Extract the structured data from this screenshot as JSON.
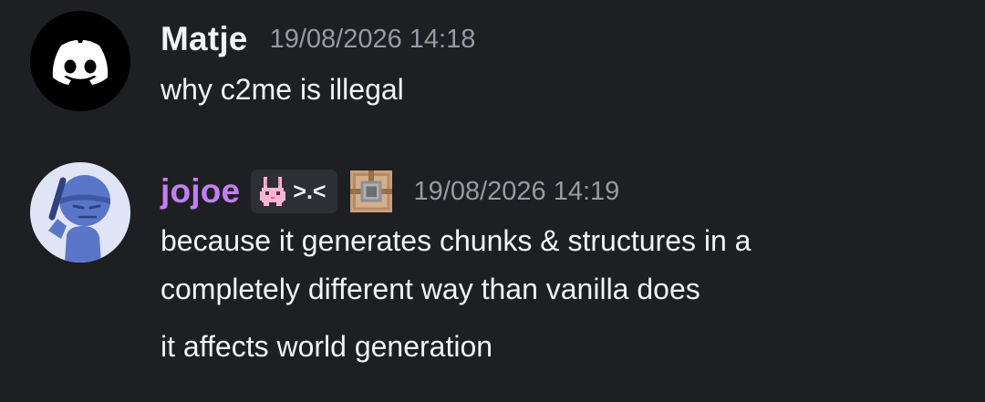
{
  "messages": [
    {
      "username": "Matje",
      "username_color": "#f2f3f5",
      "timestamp": "19/08/2026 14:18",
      "avatar_icon": "discord-logo-icon",
      "lines": [
        "why c2me is illegal"
      ]
    },
    {
      "username": "jojoe",
      "username_color": "#c27ff2",
      "timestamp": "19/08/2026 14:19",
      "avatar_icon": "user-avatar",
      "tag": {
        "icon": "bunny-icon",
        "text": ">.<"
      },
      "badge_icon": "command-block-icon",
      "lines": [
        "because it generates chunks & structures in a",
        "completely different way than vanilla does",
        "it affects world generation"
      ]
    }
  ],
  "colors": {
    "background": "#1e1f22",
    "text": "#f2f3f5",
    "timestamp": "#949ba4",
    "tag_bg": "#2e2f35"
  }
}
